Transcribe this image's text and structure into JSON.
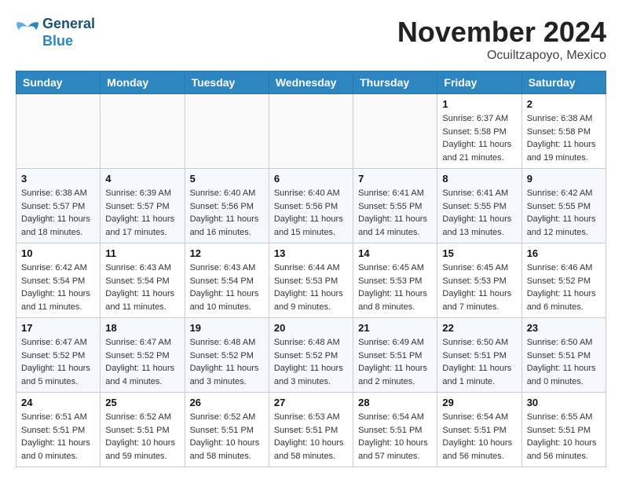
{
  "header": {
    "logo_line1": "General",
    "logo_line2": "Blue",
    "month": "November 2024",
    "location": "Ocuiltzapoyo, Mexico"
  },
  "weekdays": [
    "Sunday",
    "Monday",
    "Tuesday",
    "Wednesday",
    "Thursday",
    "Friday",
    "Saturday"
  ],
  "weeks": [
    [
      {
        "day": "",
        "info": ""
      },
      {
        "day": "",
        "info": ""
      },
      {
        "day": "",
        "info": ""
      },
      {
        "day": "",
        "info": ""
      },
      {
        "day": "",
        "info": ""
      },
      {
        "day": "1",
        "info": "Sunrise: 6:37 AM\nSunset: 5:58 PM\nDaylight: 11 hours\nand 21 minutes."
      },
      {
        "day": "2",
        "info": "Sunrise: 6:38 AM\nSunset: 5:58 PM\nDaylight: 11 hours\nand 19 minutes."
      }
    ],
    [
      {
        "day": "3",
        "info": "Sunrise: 6:38 AM\nSunset: 5:57 PM\nDaylight: 11 hours\nand 18 minutes."
      },
      {
        "day": "4",
        "info": "Sunrise: 6:39 AM\nSunset: 5:57 PM\nDaylight: 11 hours\nand 17 minutes."
      },
      {
        "day": "5",
        "info": "Sunrise: 6:40 AM\nSunset: 5:56 PM\nDaylight: 11 hours\nand 16 minutes."
      },
      {
        "day": "6",
        "info": "Sunrise: 6:40 AM\nSunset: 5:56 PM\nDaylight: 11 hours\nand 15 minutes."
      },
      {
        "day": "7",
        "info": "Sunrise: 6:41 AM\nSunset: 5:55 PM\nDaylight: 11 hours\nand 14 minutes."
      },
      {
        "day": "8",
        "info": "Sunrise: 6:41 AM\nSunset: 5:55 PM\nDaylight: 11 hours\nand 13 minutes."
      },
      {
        "day": "9",
        "info": "Sunrise: 6:42 AM\nSunset: 5:55 PM\nDaylight: 11 hours\nand 12 minutes."
      }
    ],
    [
      {
        "day": "10",
        "info": "Sunrise: 6:42 AM\nSunset: 5:54 PM\nDaylight: 11 hours\nand 11 minutes."
      },
      {
        "day": "11",
        "info": "Sunrise: 6:43 AM\nSunset: 5:54 PM\nDaylight: 11 hours\nand 11 minutes."
      },
      {
        "day": "12",
        "info": "Sunrise: 6:43 AM\nSunset: 5:54 PM\nDaylight: 11 hours\nand 10 minutes."
      },
      {
        "day": "13",
        "info": "Sunrise: 6:44 AM\nSunset: 5:53 PM\nDaylight: 11 hours\nand 9 minutes."
      },
      {
        "day": "14",
        "info": "Sunrise: 6:45 AM\nSunset: 5:53 PM\nDaylight: 11 hours\nand 8 minutes."
      },
      {
        "day": "15",
        "info": "Sunrise: 6:45 AM\nSunset: 5:53 PM\nDaylight: 11 hours\nand 7 minutes."
      },
      {
        "day": "16",
        "info": "Sunrise: 6:46 AM\nSunset: 5:52 PM\nDaylight: 11 hours\nand 6 minutes."
      }
    ],
    [
      {
        "day": "17",
        "info": "Sunrise: 6:47 AM\nSunset: 5:52 PM\nDaylight: 11 hours\nand 5 minutes."
      },
      {
        "day": "18",
        "info": "Sunrise: 6:47 AM\nSunset: 5:52 PM\nDaylight: 11 hours\nand 4 minutes."
      },
      {
        "day": "19",
        "info": "Sunrise: 6:48 AM\nSunset: 5:52 PM\nDaylight: 11 hours\nand 3 minutes."
      },
      {
        "day": "20",
        "info": "Sunrise: 6:48 AM\nSunset: 5:52 PM\nDaylight: 11 hours\nand 3 minutes."
      },
      {
        "day": "21",
        "info": "Sunrise: 6:49 AM\nSunset: 5:51 PM\nDaylight: 11 hours\nand 2 minutes."
      },
      {
        "day": "22",
        "info": "Sunrise: 6:50 AM\nSunset: 5:51 PM\nDaylight: 11 hours\nand 1 minute."
      },
      {
        "day": "23",
        "info": "Sunrise: 6:50 AM\nSunset: 5:51 PM\nDaylight: 11 hours\nand 0 minutes."
      }
    ],
    [
      {
        "day": "24",
        "info": "Sunrise: 6:51 AM\nSunset: 5:51 PM\nDaylight: 11 hours\nand 0 minutes."
      },
      {
        "day": "25",
        "info": "Sunrise: 6:52 AM\nSunset: 5:51 PM\nDaylight: 10 hours\nand 59 minutes."
      },
      {
        "day": "26",
        "info": "Sunrise: 6:52 AM\nSunset: 5:51 PM\nDaylight: 10 hours\nand 58 minutes."
      },
      {
        "day": "27",
        "info": "Sunrise: 6:53 AM\nSunset: 5:51 PM\nDaylight: 10 hours\nand 58 minutes."
      },
      {
        "day": "28",
        "info": "Sunrise: 6:54 AM\nSunset: 5:51 PM\nDaylight: 10 hours\nand 57 minutes."
      },
      {
        "day": "29",
        "info": "Sunrise: 6:54 AM\nSunset: 5:51 PM\nDaylight: 10 hours\nand 56 minutes."
      },
      {
        "day": "30",
        "info": "Sunrise: 6:55 AM\nSunset: 5:51 PM\nDaylight: 10 hours\nand 56 minutes."
      }
    ]
  ]
}
